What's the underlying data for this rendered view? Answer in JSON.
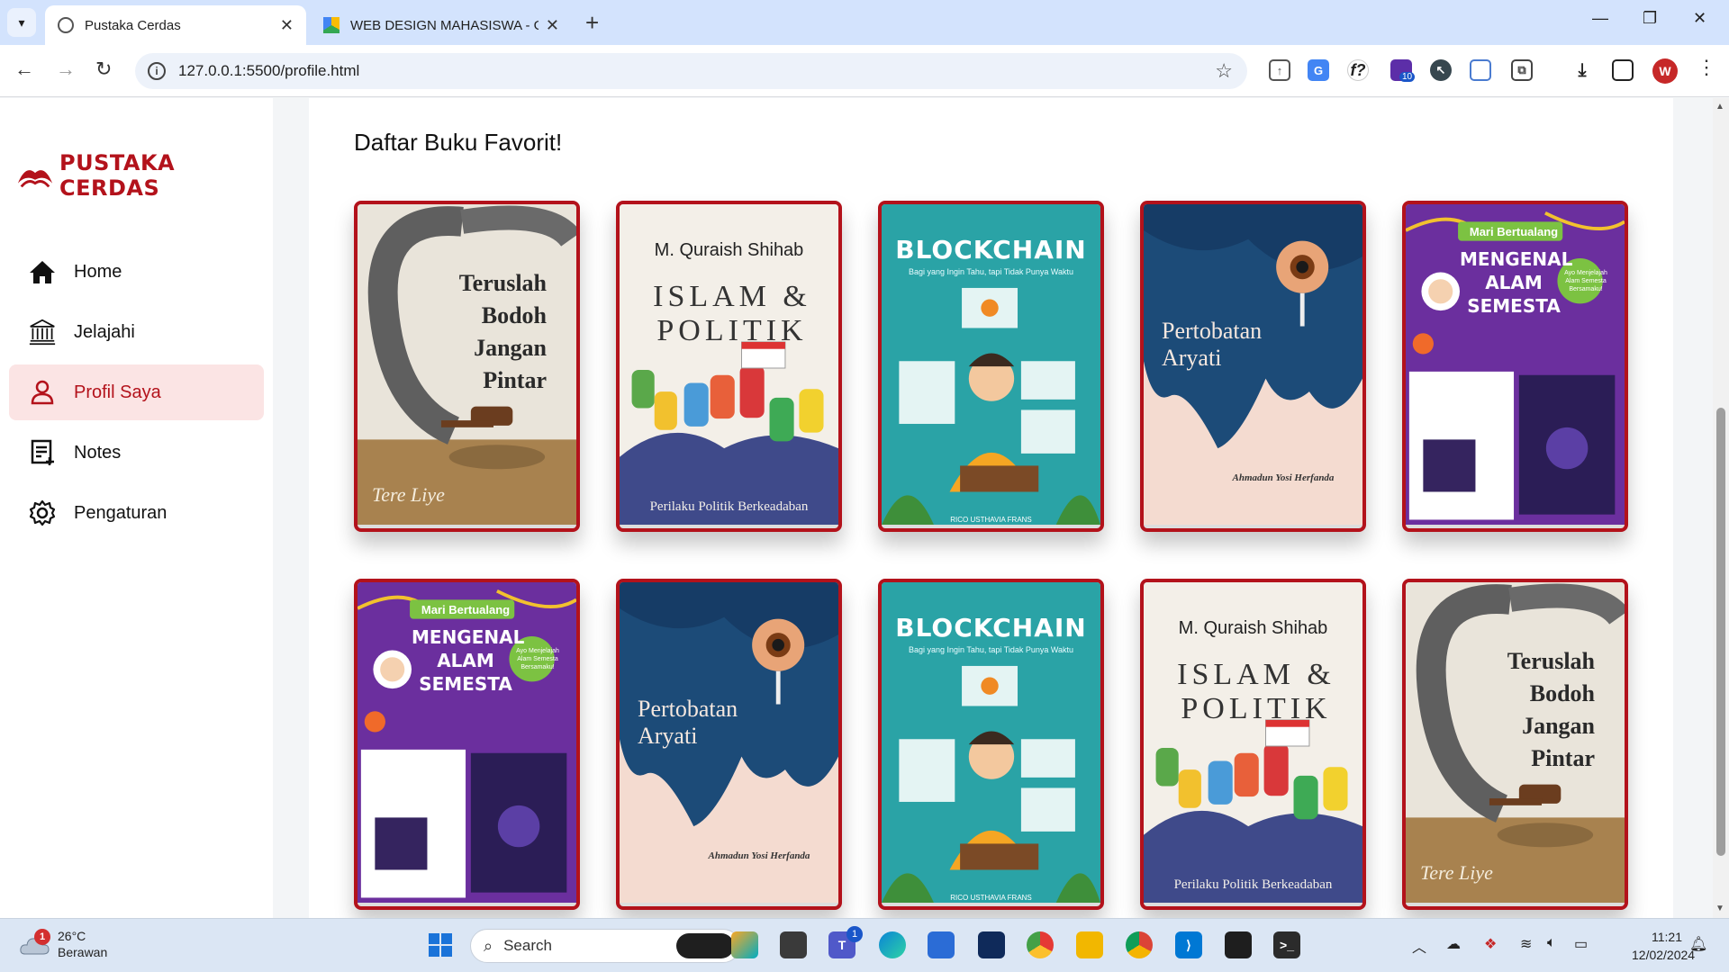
{
  "browser": {
    "tabs": [
      {
        "title": "Pustaka Cerdas",
        "active": true
      },
      {
        "title": "WEB DESIGN MAHASISWA - Go",
        "active": false
      }
    ],
    "url": "127.0.0.1:5500/profile.html",
    "profile_initial": "W",
    "extension_badge": "10"
  },
  "sidebar": {
    "logo_text": "PUSTAKA CERDAS",
    "items": [
      {
        "label": "Home",
        "icon": "home-icon",
        "active": false
      },
      {
        "label": "Jelajahi",
        "icon": "library-icon",
        "active": false
      },
      {
        "label": "Profil Saya",
        "icon": "user-icon",
        "active": true
      },
      {
        "label": "Notes",
        "icon": "notes-icon",
        "active": false
      },
      {
        "label": "Pengaturan",
        "icon": "gear-icon",
        "active": false
      }
    ]
  },
  "main": {
    "section_title": "Daftar Buku Favorit!",
    "books": [
      {
        "kind": "teruslah",
        "title": "Teruslah Bodoh Jangan Pintar",
        "author": "Tere Liye"
      },
      {
        "kind": "islam",
        "title": "ISLAM & POLITIK",
        "author": "M. Quraish Shihab",
        "subtitle": "Perilaku Politik Berkeadaban"
      },
      {
        "kind": "blockchain",
        "title": "BLOCKCHAIN",
        "subtitle": "Bagi yang Ingin Tahu, tapi Tidak Punya Waktu",
        "author": "RICO USTHAVIA FRANS"
      },
      {
        "kind": "pertobatan",
        "title": "Pertobatan Aryati",
        "author": "Ahmadun Yosi Herfanda"
      },
      {
        "kind": "alam",
        "banner": "Mari Bertualang",
        "title": "MENGENAL ALAM SEMESTA",
        "badge": "Ayo Menjelajah Alam Semesta Bersamaku!"
      },
      {
        "kind": "alam",
        "banner": "Mari Bertualang",
        "title": "MENGENAL ALAM SEMESTA",
        "badge": "Ayo Menjelajah Alam Semesta Bersamaku!"
      },
      {
        "kind": "pertobatan",
        "title": "Pertobatan Aryati",
        "author": "Ahmadun Yosi Herfanda"
      },
      {
        "kind": "blockchain",
        "title": "BLOCKCHAIN",
        "subtitle": "Bagi yang Ingin Tahu, tapi Tidak Punya Waktu",
        "author": "RICO USTHAVIA FRANS"
      },
      {
        "kind": "islam",
        "title": "ISLAM & POLITIK",
        "author": "M. Quraish Shihab",
        "subtitle": "Perilaku Politik Berkeadaban"
      },
      {
        "kind": "teruslah",
        "title": "Teruslah Bodoh Jangan Pintar",
        "author": "Tere Liye"
      }
    ]
  },
  "taskbar": {
    "weather_temp": "26°C",
    "weather_desc": "Berawan",
    "weather_badge": "1",
    "search_placeholder": "Search",
    "teams_badge": "1",
    "time": "11:21",
    "date": "12/02/2024"
  },
  "colors": {
    "brand": "#b3121b",
    "active_bg": "#fbe4e4",
    "tabbar": "#d3e3fd"
  }
}
